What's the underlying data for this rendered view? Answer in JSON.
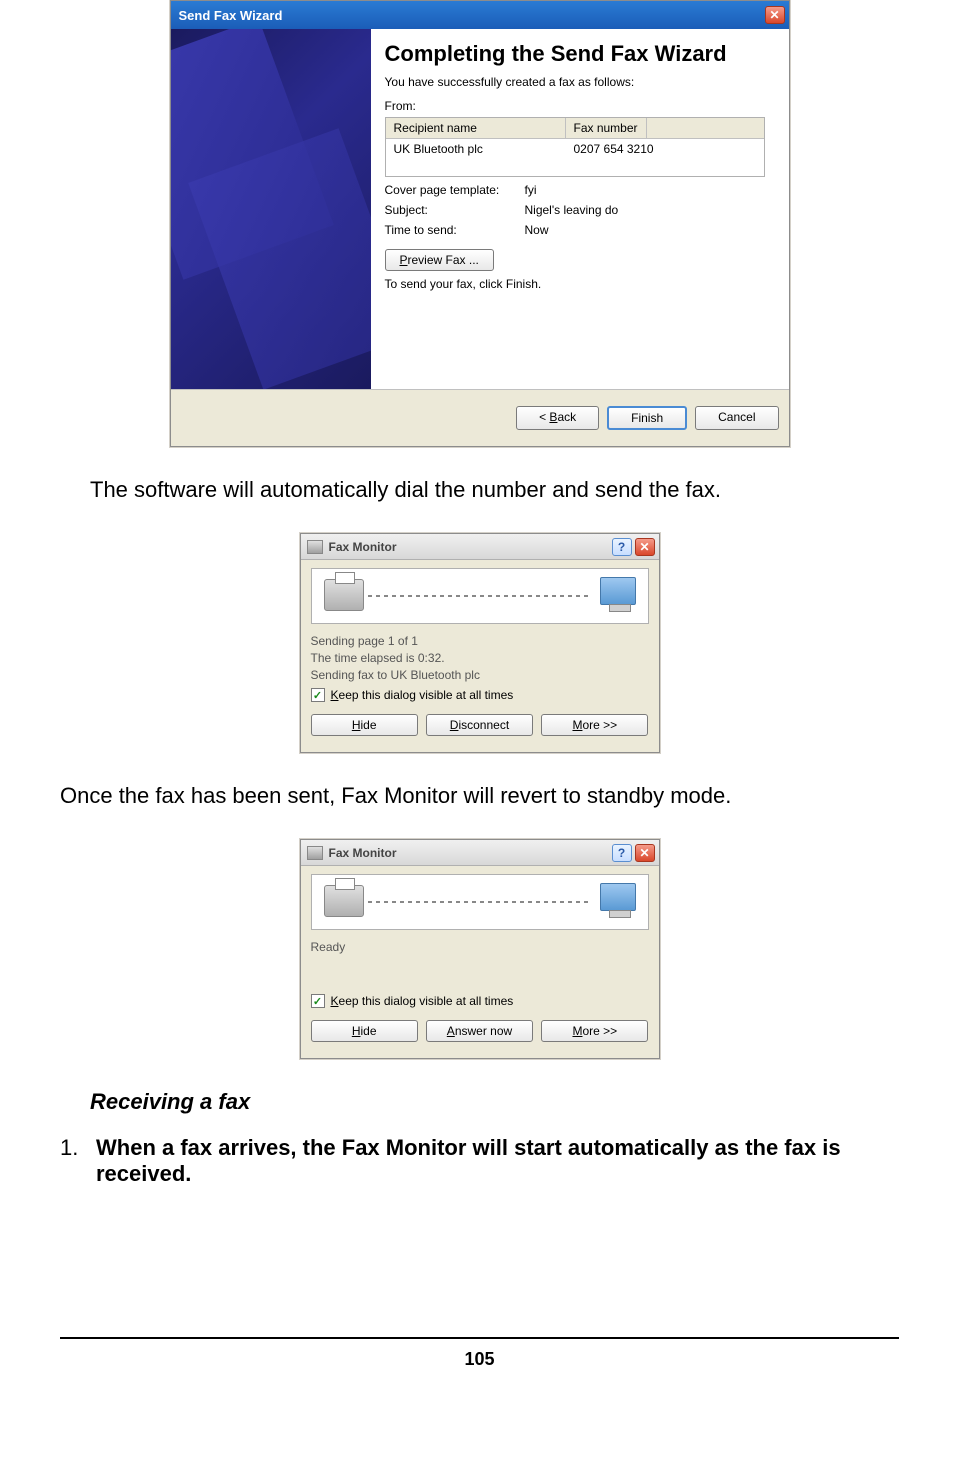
{
  "wizard": {
    "title": "Send Fax Wizard",
    "heading": "Completing the Send Fax Wizard",
    "subtitle": "You have successfully created a fax as follows:",
    "from_label": "From:",
    "table_headers": {
      "name": "Recipient name",
      "fax": "Fax number"
    },
    "table_row": {
      "name": "UK Bluetooth plc",
      "fax": "0207 654 3210"
    },
    "fields": {
      "cover_label": "Cover page template:",
      "cover_value": "fyi",
      "subject_label": "Subject:",
      "subject_value": "Nigel's leaving do",
      "time_label": "Time to send:",
      "time_value": "Now"
    },
    "preview_button": "Preview Fax ...",
    "instruction": "To send your fax, click Finish.",
    "back_button": "< Back",
    "finish_button": "Finish",
    "cancel_button": "Cancel"
  },
  "narrative": {
    "line1": "The software will automatically dial the number and send the fax.",
    "line2": "Once the fax has been sent, Fax Monitor will revert to standby mode."
  },
  "monitor1": {
    "title": "Fax Monitor",
    "lines": {
      "l1": "Sending page 1 of 1",
      "l2": "The time elapsed is 0:32.",
      "l3": "Sending fax to UK Bluetooth plc"
    },
    "checkbox_label": "Keep this dialog visible at all times",
    "buttons": {
      "hide": "Hide",
      "disconnect": "Disconnect",
      "more": "More >>"
    }
  },
  "monitor2": {
    "title": "Fax Monitor",
    "lines": {
      "l1": "Ready"
    },
    "checkbox_label": "Keep this dialog visible at all times",
    "buttons": {
      "hide": "Hide",
      "answer": "Answer now",
      "more": "More >>"
    }
  },
  "section_heading": "Receiving a fax",
  "step1": {
    "num": "1.",
    "text": "When a fax arrives, the Fax Monitor will start automatically as the fax is received."
  },
  "page_number": "105"
}
